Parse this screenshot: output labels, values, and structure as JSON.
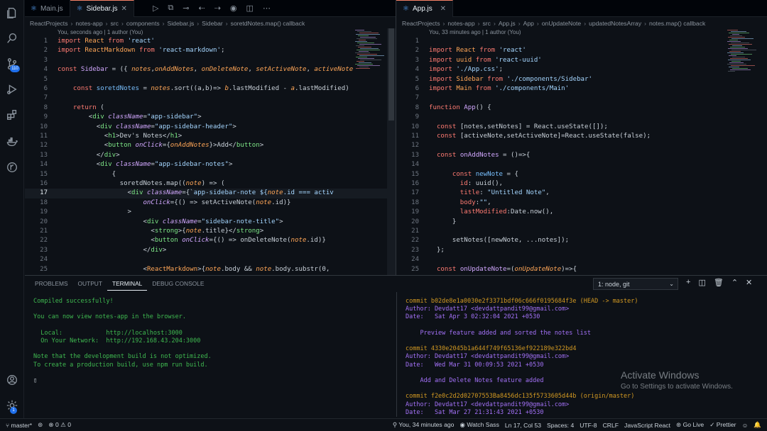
{
  "left_editor": {
    "tabs": [
      {
        "label": "Main.js",
        "active": false
      },
      {
        "label": "Sidebar.js",
        "active": true
      }
    ],
    "breadcrumb": [
      "ReactProjects",
      "notes-app",
      "src",
      "components",
      "Sidebar.js",
      "Sidebar",
      "soretdNotes.map() callback"
    ],
    "codelens": "You, seconds ago | 1 author (You)",
    "first_line": 1,
    "lines": [
      [
        [
          "import ",
          "kw"
        ],
        [
          "React ",
          "cls"
        ],
        [
          "from ",
          "kw"
        ],
        [
          "'react'",
          "str"
        ]
      ],
      [
        [
          "import ",
          "kw"
        ],
        [
          "ReactMarkdown ",
          "cls"
        ],
        [
          "from ",
          "kw"
        ],
        [
          "'react-markdown'",
          "str"
        ],
        [
          ";",
          "p"
        ]
      ],
      [],
      [
        [
          "const ",
          "kw"
        ],
        [
          "Sidebar ",
          "fn"
        ],
        [
          "= ",
          "p"
        ],
        [
          "({ ",
          "p"
        ],
        [
          "notes",
          "par"
        ],
        [
          ",",
          "p"
        ],
        [
          "onAddNotes",
          "par"
        ],
        [
          ", ",
          "p"
        ],
        [
          "onDeleteNote",
          "par"
        ],
        [
          ", ",
          "p"
        ],
        [
          "setActiveNote",
          "par"
        ],
        [
          ", ",
          "p"
        ],
        [
          "activeNote",
          "par"
        ]
      ],
      [],
      [
        [
          "    const ",
          "kw"
        ],
        [
          "soretdNotes ",
          "v"
        ],
        [
          "= ",
          "p"
        ],
        [
          "notes",
          "par"
        ],
        [
          ".sort((a,b)=> ",
          "p"
        ],
        [
          "b",
          "par"
        ],
        [
          ".lastModified - ",
          "p"
        ],
        [
          "a",
          "par"
        ],
        [
          ".lastModified)",
          "p"
        ]
      ],
      [],
      [
        [
          "    return ",
          "kw"
        ],
        [
          "(",
          "p"
        ]
      ],
      [
        [
          "        <",
          "p"
        ],
        [
          "div ",
          "tag"
        ],
        [
          "className",
          "attr"
        ],
        [
          "=",
          "p"
        ],
        [
          "\"app-sidebar\"",
          "str"
        ],
        [
          ">",
          "p"
        ]
      ],
      [
        [
          "          <",
          "p"
        ],
        [
          "div ",
          "tag"
        ],
        [
          "className",
          "attr"
        ],
        [
          "=",
          "p"
        ],
        [
          "\"app-sidebar-header\"",
          "str"
        ],
        [
          ">",
          "p"
        ]
      ],
      [
        [
          "            <",
          "p"
        ],
        [
          "h1",
          "tag"
        ],
        [
          ">Dev's Notes</",
          "p"
        ],
        [
          "h1",
          "tag"
        ],
        [
          ">",
          "p"
        ]
      ],
      [
        [
          "            <",
          "p"
        ],
        [
          "button ",
          "tag"
        ],
        [
          "onClick",
          "attr"
        ],
        [
          "={",
          "p"
        ],
        [
          "onAddNotes",
          "par"
        ],
        [
          "}>Add</",
          "p"
        ],
        [
          "button",
          "tag"
        ],
        [
          ">",
          "p"
        ]
      ],
      [
        [
          "          </",
          "p"
        ],
        [
          "div",
          "tag"
        ],
        [
          ">",
          "p"
        ]
      ],
      [
        [
          "          <",
          "p"
        ],
        [
          "div ",
          "tag"
        ],
        [
          "className",
          "attr"
        ],
        [
          "=",
          "p"
        ],
        [
          "\"app-sidebar-notes\"",
          "str"
        ],
        [
          ">",
          "p"
        ]
      ],
      [
        [
          "              {",
          "p"
        ]
      ],
      [
        [
          "                soretdNotes.map((",
          "p"
        ],
        [
          "note",
          "par"
        ],
        [
          ") => (",
          "p"
        ]
      ],
      [
        [
          "                  <",
          "p"
        ],
        [
          "div ",
          "tag"
        ],
        [
          "className",
          "attr"
        ],
        [
          "={`",
          "p"
        ],
        [
          "app-sidebar-note ${",
          "str"
        ],
        [
          "note",
          "par"
        ],
        [
          ".id === activ",
          "str"
        ]
      ],
      [
        [
          "                      onClick",
          "attr"
        ],
        [
          "={() => setActiveNote(",
          "p"
        ],
        [
          "note",
          "par"
        ],
        [
          ".id)}",
          "p"
        ]
      ],
      [
        [
          "                  >",
          "p"
        ]
      ],
      [
        [
          "                      <",
          "p"
        ],
        [
          "div ",
          "tag"
        ],
        [
          "className",
          "attr"
        ],
        [
          "=",
          "p"
        ],
        [
          "\"sidebar-note-title\"",
          "str"
        ],
        [
          ">",
          "p"
        ]
      ],
      [
        [
          "                        <",
          "p"
        ],
        [
          "strong",
          "tag"
        ],
        [
          ">{",
          "p"
        ],
        [
          "note",
          "par"
        ],
        [
          ".title}</",
          "p"
        ],
        [
          "strong",
          "tag"
        ],
        [
          ">",
          "p"
        ]
      ],
      [
        [
          "                        <",
          "p"
        ],
        [
          "button ",
          "tag"
        ],
        [
          "onClick",
          "attr"
        ],
        [
          "={() => onDeleteNote(",
          "p"
        ],
        [
          "note",
          "par"
        ],
        [
          ".id)}",
          "p"
        ]
      ],
      [
        [
          "                      </",
          "p"
        ],
        [
          "div",
          "tag"
        ],
        [
          ">",
          "p"
        ]
      ],
      [],
      [
        [
          "                      <",
          "p"
        ],
        [
          "ReactMarkdown",
          "cls"
        ],
        [
          ">{",
          "p"
        ],
        [
          "note",
          "par"
        ],
        [
          ".body && ",
          "p"
        ],
        [
          "note",
          "par"
        ],
        [
          ".body.substr(0,",
          "p"
        ]
      ]
    ]
  },
  "right_editor": {
    "tabs": [
      {
        "label": "App.js",
        "active": true
      }
    ],
    "breadcrumb": [
      "ReactProjects",
      "notes-app",
      "src",
      "App.js",
      "App",
      "onUpdateNote",
      "updatedNotesArray",
      "notes.map() callback"
    ],
    "codelens": "You, 33 minutes ago | 1 author (You)",
    "first_line": 1,
    "lines": [
      [],
      [
        [
          "import ",
          "kw"
        ],
        [
          "React ",
          "cls"
        ],
        [
          "from ",
          "kw"
        ],
        [
          "'react'",
          "str"
        ]
      ],
      [
        [
          "import ",
          "kw"
        ],
        [
          "uuid ",
          "cls"
        ],
        [
          "from ",
          "kw"
        ],
        [
          "'react-uuid'",
          "str"
        ]
      ],
      [
        [
          "import ",
          "kw"
        ],
        [
          "'./App.css'",
          "str"
        ],
        [
          ";",
          "p"
        ]
      ],
      [
        [
          "import ",
          "kw"
        ],
        [
          "Sidebar ",
          "cls"
        ],
        [
          "from ",
          "kw"
        ],
        [
          "'./components/Sidebar'",
          "str"
        ]
      ],
      [
        [
          "import ",
          "kw"
        ],
        [
          "Main ",
          "cls"
        ],
        [
          "from ",
          "kw"
        ],
        [
          "'./components/Main'",
          "str"
        ]
      ],
      [],
      [
        [
          "function ",
          "kw"
        ],
        [
          "App",
          "fn"
        ],
        [
          "() {",
          "p"
        ]
      ],
      [],
      [
        [
          "  const ",
          "kw"
        ],
        [
          "[notes,setNotes] = React.useState([]);",
          "p"
        ]
      ],
      [
        [
          "  const ",
          "kw"
        ],
        [
          "[activeNote,setActiveNote]=React.useState(false);",
          "p"
        ]
      ],
      [],
      [
        [
          "  const ",
          "kw"
        ],
        [
          "onAddNotes ",
          "fn"
        ],
        [
          "= ()=>{",
          "p"
        ]
      ],
      [],
      [
        [
          "      const ",
          "kw"
        ],
        [
          "newNote ",
          "v"
        ],
        [
          "= {",
          "p"
        ]
      ],
      [
        [
          "        id",
          "prop"
        ],
        [
          ": uuid(),",
          "p"
        ]
      ],
      [
        [
          "        title",
          "prop"
        ],
        [
          ": ",
          "p"
        ],
        [
          "\"Untitled Note\"",
          "str"
        ],
        [
          ",",
          "p"
        ]
      ],
      [
        [
          "        body",
          "prop"
        ],
        [
          ":",
          "p"
        ],
        [
          "\"\"",
          "str"
        ],
        [
          ",",
          "p"
        ]
      ],
      [
        [
          "        lastModified",
          "prop"
        ],
        [
          ":Date.now(),",
          "p"
        ]
      ],
      [
        [
          "      }",
          "p"
        ]
      ],
      [],
      [
        [
          "      setNotes([newNote, ...notes]);",
          "p"
        ]
      ],
      [
        [
          "  };",
          "p"
        ]
      ],
      [],
      [
        [
          "  const ",
          "kw"
        ],
        [
          "onUpdateNote",
          "fn"
        ],
        [
          "=(",
          "p"
        ],
        [
          "onUpdateNote",
          "par"
        ],
        [
          ")=>{",
          "p"
        ]
      ]
    ]
  },
  "colors": {
    "kw": "#ff7b72",
    "str": "#a5d6ff",
    "fn": "#d2a8ff",
    "cls": "#ffa657",
    "par": "#ffa657",
    "tag": "#7ee787",
    "attr": "#d2a8ff",
    "prop": "#ff7b72",
    "v": "#79c0ff",
    "p": "#c9d1d9"
  },
  "panel": {
    "tabs": [
      "PROBLEMS",
      "OUTPUT",
      "TERMINAL",
      "DEBUG CONSOLE"
    ],
    "active_tab": "TERMINAL",
    "terminal_select": "1: node, git",
    "left_terminal": [
      {
        "t": "Compiled successfully!",
        "c": "#3fb950"
      },
      {
        "t": "",
        "c": ""
      },
      {
        "t": "You can now view notes-app in the browser.",
        "c": "#3fb950"
      },
      {
        "t": "",
        "c": ""
      },
      {
        "t": "  Local:            http://localhost:3000",
        "c": "#3fb950"
      },
      {
        "t": "  On Your Network:  http://192.168.43.204:3000",
        "c": "#3fb950"
      },
      {
        "t": "",
        "c": ""
      },
      {
        "t": "Note that the development build is not optimized.",
        "c": "#3fb950"
      },
      {
        "t": "To create a production build, use npm run build.",
        "c": "#3fb950"
      },
      {
        "t": "",
        "c": ""
      },
      {
        "t": "▯",
        "c": "#c9d1d9"
      }
    ],
    "right_terminal": [
      {
        "t": "commit b02de8e1a0030e2f3371bdf06c666f0195684f3e (HEAD -> master)",
        "c": "#d29922"
      },
      {
        "t": "Author: Devdatt17 <devdattpandit99@gmail.com>",
        "c": "#a371f7"
      },
      {
        "t": "Date:   Sat Apr 3 02:32:04 2021 +0530",
        "c": "#a371f7"
      },
      {
        "t": "",
        "c": ""
      },
      {
        "t": "    Preview feature added and sorted the notes list",
        "c": "#a371f7"
      },
      {
        "t": "",
        "c": ""
      },
      {
        "t": "commit 4330e2045b1a644f749f65136ef922189e322bd4",
        "c": "#d29922"
      },
      {
        "t": "Author: Devdatt17 <devdattpandit99@gmail.com>",
        "c": "#a371f7"
      },
      {
        "t": "Date:   Wed Mar 31 00:09:53 2021 +0530",
        "c": "#a371f7"
      },
      {
        "t": "",
        "c": ""
      },
      {
        "t": "    Add and Delete Notes feature added",
        "c": "#a371f7"
      },
      {
        "t": "",
        "c": ""
      },
      {
        "t": "commit f2e0c2d2d02707553Ba8456dc135f5733605d44b (origin/master)",
        "c": "#d29922"
      },
      {
        "t": "Author: Devdatt17 <devdattpandit99@gmail.com>",
        "c": "#a371f7"
      },
      {
        "t": "Date:   Sat Mar 27 21:31:43 2021 +0530",
        "c": "#a371f7"
      }
    ]
  },
  "watermark": {
    "title": "Activate Windows",
    "subtitle": "Go to Settings to activate Windows."
  },
  "status": {
    "branch": "master*",
    "problems": "⊗ 0 ⚠ 0",
    "blame": "You, 34 minutes ago",
    "sass": "Watch Sass",
    "position": "Ln 17, Col 53",
    "spaces": "Spaces: 4",
    "encoding": "UTF-8",
    "eol": "CRLF",
    "language": "JavaScript React",
    "golive": "Go Live",
    "prettier": "✓ Prettier"
  },
  "activity_badges": {
    "source_control": "110",
    "accounts": "1"
  }
}
